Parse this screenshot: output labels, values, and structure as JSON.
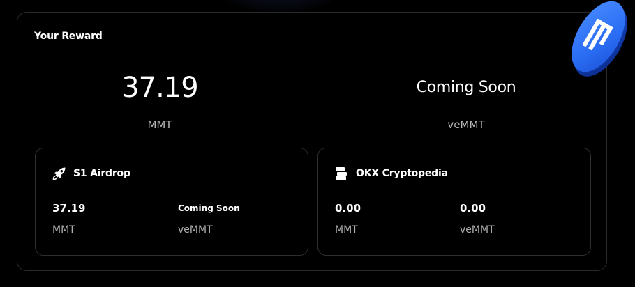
{
  "reward": {
    "title": "Your Reward",
    "mmt_value": "37.19",
    "mmt_unit": "MMT",
    "vemmt_value": "Coming Soon",
    "vemmt_unit": "veMMT"
  },
  "sources": [
    {
      "name": "S1 Airdrop",
      "icon": "rocket-icon",
      "mmt_value": "37.19",
      "mmt_unit": "MMT",
      "vemmt_value": "Coming Soon",
      "vemmt_unit": "veMMT"
    },
    {
      "name": "OKX Cryptopedia",
      "icon": "okx-cryptopedia-icon",
      "mmt_value": "0.00",
      "mmt_unit": "MMT",
      "vemmt_value": "0.00",
      "vemmt_unit": "veMMT"
    }
  ],
  "decoration": {
    "coin_icon": "mmt-coin-logo",
    "accent_color": "#2a6df4"
  }
}
